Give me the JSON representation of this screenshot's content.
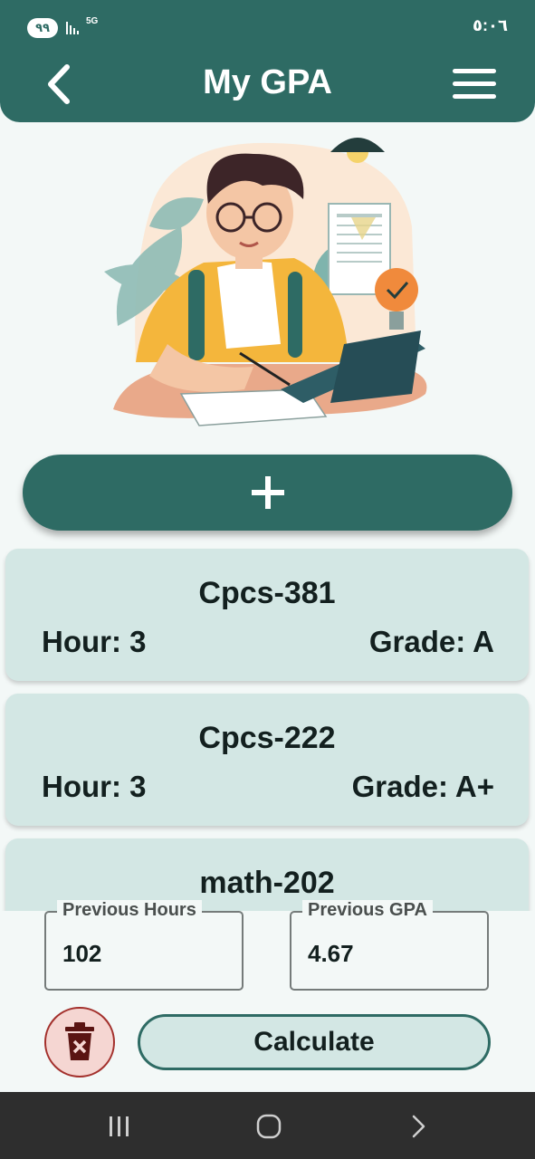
{
  "status_bar": {
    "battery": "٩٩",
    "network": "5G",
    "time": "٥:٠٦"
  },
  "header": {
    "title": "My GPA"
  },
  "icons": {
    "back": "chevron-left-icon",
    "menu": "hamburger-menu-icon",
    "add": "plus-icon",
    "delete": "trash-x-icon"
  },
  "courses": [
    {
      "name": "Cpcs-381",
      "hour_text": "Hour: 3",
      "grade_text": "Grade: A"
    },
    {
      "name": "Cpcs-222",
      "hour_text": "Hour: 3",
      "grade_text": "Grade: A+"
    },
    {
      "name": "math-202",
      "hour_text": "",
      "grade_text": ""
    }
  ],
  "previous_hours": {
    "label": "Previous Hours",
    "value": "102"
  },
  "previous_gpa": {
    "label": "Previous GPA",
    "value": "4.67"
  },
  "actions": {
    "calculate_label": "Calculate"
  },
  "colors": {
    "primary": "#2e6b64",
    "card": "#d3e7e4",
    "background": "#f3f8f7",
    "delete_bg": "#f5d6d2",
    "delete_accent": "#a3302c",
    "illustration_shirt": "#f4b63c",
    "illustration_lamp": "#f08a3c"
  }
}
